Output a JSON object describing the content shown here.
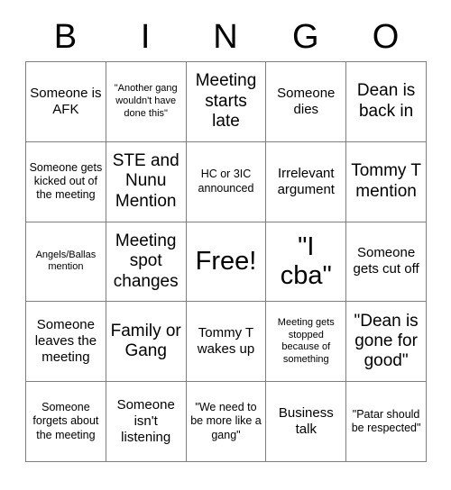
{
  "header": {
    "letters": [
      "B",
      "I",
      "N",
      "G",
      "O"
    ]
  },
  "colors": {
    "background": "#ffffff",
    "text": "#000000",
    "cell_border": "#7f7f7f"
  },
  "grid": {
    "rows": 5,
    "columns": 5,
    "cells": [
      [
        {
          "text": "Someone is AFK",
          "size": "m"
        },
        {
          "text": "\"Another gang wouldn't have done this\"",
          "size": "xs"
        },
        {
          "text": "Meeting starts late",
          "size": "l"
        },
        {
          "text": "Someone dies",
          "size": "m"
        },
        {
          "text": "Dean is back in",
          "size": "l"
        }
      ],
      [
        {
          "text": "Someone gets kicked out of the meeting",
          "size": "s"
        },
        {
          "text": "STE and Nunu Mention",
          "size": "l"
        },
        {
          "text": "HC or 3IC announced",
          "size": "s"
        },
        {
          "text": "Irrelevant argument",
          "size": "m"
        },
        {
          "text": "Tommy T mention",
          "size": "l"
        }
      ],
      [
        {
          "text": "Angels/Ballas mention",
          "size": "xs"
        },
        {
          "text": "Meeting spot changes",
          "size": "l"
        },
        {
          "text": "Free!",
          "size": "xxl"
        },
        {
          "text": "\"I cba\"",
          "size": "xxl"
        },
        {
          "text": "Someone gets cut off",
          "size": "m"
        }
      ],
      [
        {
          "text": "Someone leaves the meeting",
          "size": "m"
        },
        {
          "text": "Family or Gang",
          "size": "l"
        },
        {
          "text": "Tommy T wakes up",
          "size": "m"
        },
        {
          "text": "Meeting gets stopped because of something",
          "size": "xs"
        },
        {
          "text": "\"Dean is gone for good\"",
          "size": "l"
        }
      ],
      [
        {
          "text": "Someone forgets about the meeting",
          "size": "s"
        },
        {
          "text": "Someone isn't listening",
          "size": "m"
        },
        {
          "text": "\"We need to be more like a gang\"",
          "size": "s"
        },
        {
          "text": "Business talk",
          "size": "m"
        },
        {
          "text": "\"Patar should be respected\"",
          "size": "s"
        }
      ]
    ]
  }
}
